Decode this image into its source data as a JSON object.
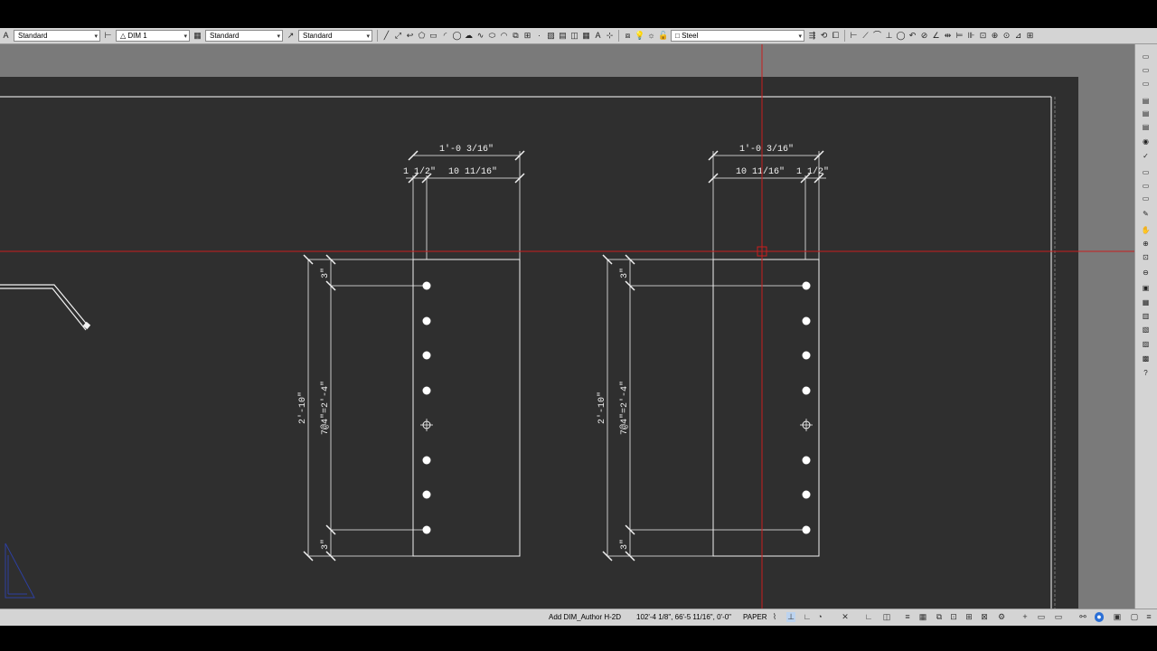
{
  "toolbar": {
    "text_style": "Standard",
    "dim_style_icon": "dim-style-icon",
    "dim_style": "DIM 1",
    "table_style": "Standard",
    "mleader_style": "Standard",
    "layer": "Steel"
  },
  "drawing": {
    "left": {
      "overall_width": "1'-0 3/16\"",
      "edge_dim": "1 1/2\"",
      "inner_width": "10 11/16\"",
      "top_spacing": "3\"",
      "bottom_spacing": "3\"",
      "overall_height": "2'-10\"",
      "hole_spacing": "7@4\"=2'-4\""
    },
    "right": {
      "overall_width": "1'-0 3/16\"",
      "inner_width": "10 11/16\"",
      "edge_dim": "1 1/2\"",
      "top_spacing": "3\"",
      "bottom_spacing": "3\"",
      "overall_height": "2'-10\"",
      "hole_spacing": "7@4\"=2'-4\""
    }
  },
  "status": {
    "command": "Add DIM_Author H-2D",
    "coordinates": "102'-4 1/8\", 66'-5 11/16\", 0'-0\"",
    "space": "PAPER"
  },
  "colors": {
    "background": "#2f2f2f",
    "crosshair": "#c81e1e",
    "lines": "#f2f2f2",
    "ucs_icon": "#2d3fa0"
  }
}
